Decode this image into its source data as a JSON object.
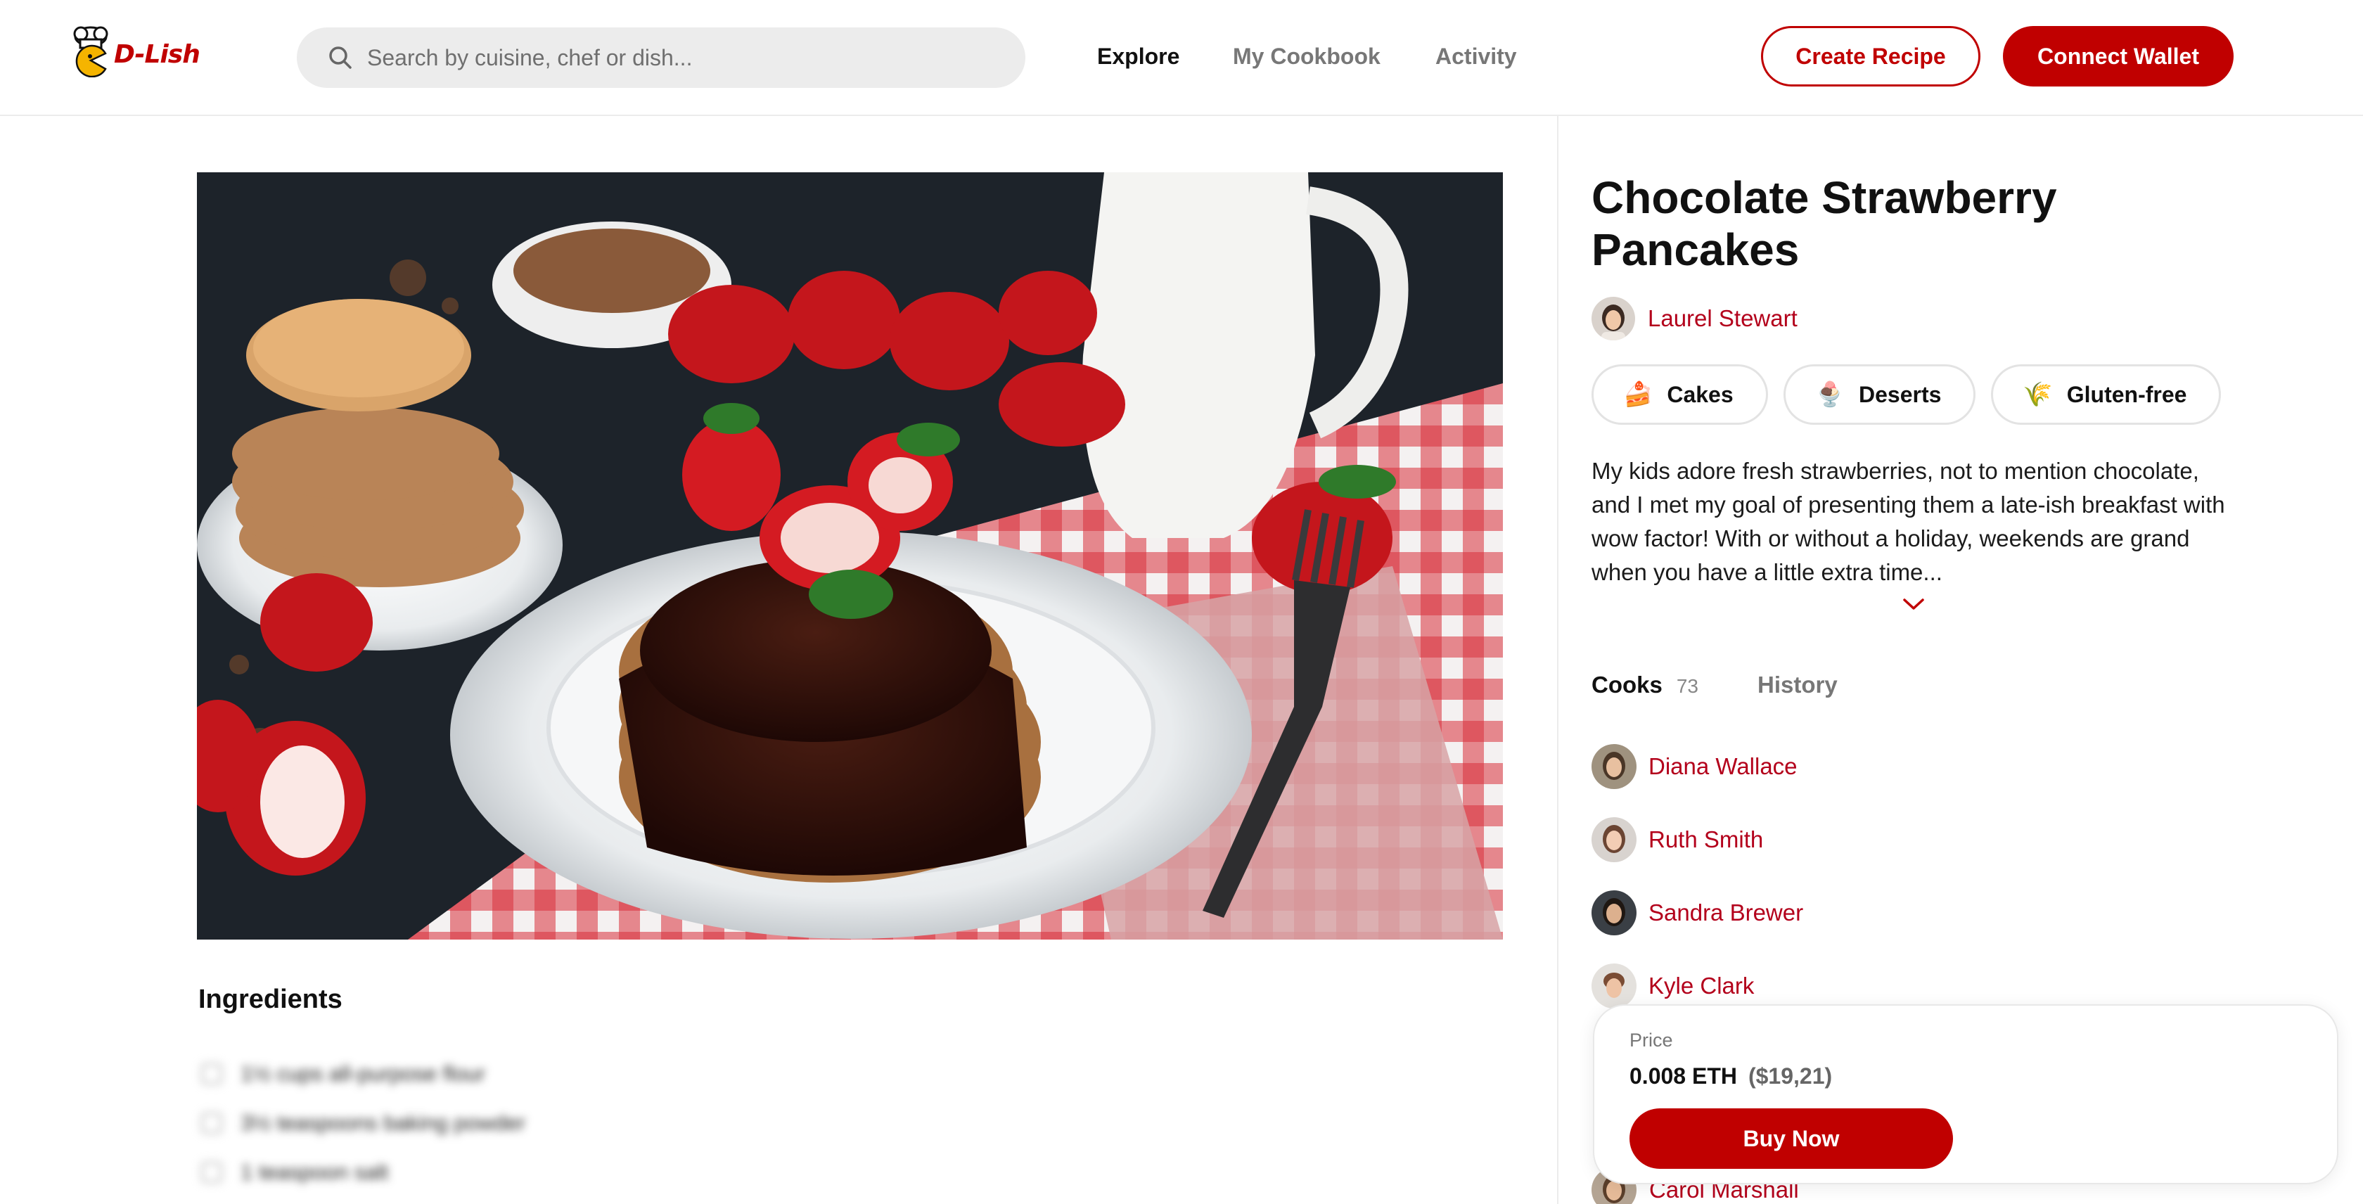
{
  "header": {
    "logo_text": "D-Lish",
    "search_placeholder": "Search by cuisine, chef or dish...",
    "nav": [
      {
        "label": "Explore",
        "active": true
      },
      {
        "label": "My Cookbook",
        "active": false
      },
      {
        "label": "Activity",
        "active": false
      }
    ],
    "create_recipe_label": "Create Recipe",
    "connect_wallet_label": "Connect Wallet"
  },
  "recipe": {
    "title": "Chocolate Strawberry Pancakes",
    "author": "Laurel Stewart",
    "tags": [
      {
        "label": "Cakes",
        "icon": "cake-icon"
      },
      {
        "label": "Deserts",
        "icon": "dessert-icon"
      },
      {
        "label": "Gluten-free",
        "icon": "wheat-icon"
      }
    ],
    "description": "My kids adore fresh strawberries, not to mention chocolate, and I met my goal of presenting them a late-ish breakfast with wow factor! With or without a holiday, weekends are grand when you have a little extra time..."
  },
  "ingredients": {
    "title": "Ingredients",
    "items": [
      "1½ cups all-purpose flour",
      "3½ teaspoons baking powder",
      "1 teaspoon salt"
    ]
  },
  "tabs": {
    "cooks_label": "Cooks",
    "cooks_count": "73",
    "history_label": "History"
  },
  "cooks": [
    {
      "name": "Diana Wallace"
    },
    {
      "name": "Ruth Smith"
    },
    {
      "name": "Sandra Brewer"
    },
    {
      "name": "Kyle Clark"
    },
    {
      "name": "Carol Marshall"
    }
  ],
  "purchase": {
    "price_label": "Price",
    "price_eth": "0.008 ETH",
    "price_usd": "($19,21)",
    "buy_label": "Buy Now"
  },
  "colors": {
    "brand": "#c00000",
    "link": "#b3001b",
    "border": "#e3e3e3"
  }
}
